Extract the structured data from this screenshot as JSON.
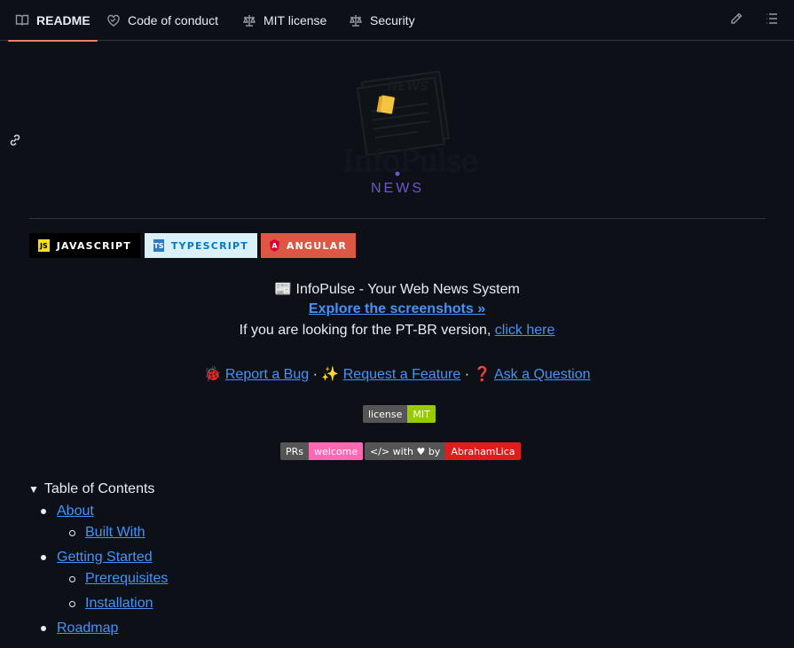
{
  "tabs": [
    {
      "label": "README",
      "icon": "book-icon",
      "active": true
    },
    {
      "label": "Code of conduct",
      "icon": "code-of-conduct-icon"
    },
    {
      "label": "MIT license",
      "icon": "law-icon"
    },
    {
      "label": "Security",
      "icon": "law-icon"
    }
  ],
  "toolbar": {
    "edit_icon": "pencil-icon",
    "outline_icon": "list-icon"
  },
  "logo": {
    "word": "InfoPulse",
    "sub": "NEWS",
    "badge_text": "NEWS"
  },
  "tech_badges": [
    {
      "label": "JAVASCRIPT",
      "icon_text": "JS",
      "bg": "#000000",
      "color": "#ffffff",
      "icon_bg": "#f7df1e",
      "icon_color": "#000000"
    },
    {
      "label": "TYPESCRIPT",
      "icon_text": "TS",
      "bg": "#dbf1fa",
      "color": "#007acc",
      "icon_bg": "#3178c6",
      "icon_color": "#ffffff"
    },
    {
      "label": "ANGULAR",
      "icon_text": "A",
      "bg": "#dd5844",
      "color": "#ffffff",
      "icon_bg": "#dd0031",
      "icon_color": "#ffffff"
    }
  ],
  "intro": {
    "emoji": "📰",
    "title": "InfoPulse - Your Web News System",
    "screenshots_link": "Explore the screenshots »",
    "ptbr_text": "If you are looking for the PT-BR version,",
    "ptbr_link": "click here"
  },
  "actions": {
    "bug_emoji": "🐞",
    "bug": "Report a Bug",
    "sep1": "·",
    "feature_emoji": "✨",
    "feature": "Request a Feature",
    "sep2": "·",
    "question_emoji": "❓",
    "question": "Ask a Question"
  },
  "shields": {
    "license": {
      "left": "license",
      "right": "MIT",
      "right_bg": "#97ca00"
    },
    "prs": {
      "left": "PRs",
      "right": "welcome",
      "right_bg": "#ff69b4"
    },
    "made_by": {
      "left": "</> with ♥ by",
      "right": "AbrahamLica",
      "right_bg": "#e01d1d"
    }
  },
  "toc": {
    "title": "Table of Contents",
    "items": [
      {
        "label": "About",
        "level": 1
      },
      {
        "label": "Built With",
        "level": 2
      },
      {
        "label": "Getting Started",
        "level": 1
      },
      {
        "label": "Prerequisites",
        "level": 2
      },
      {
        "label": "Installation",
        "level": 2
      },
      {
        "label": "Roadmap",
        "level": 1
      }
    ]
  },
  "colors": {
    "background": "#0d1117",
    "link": "#4493f8",
    "accent": "#f78166"
  }
}
